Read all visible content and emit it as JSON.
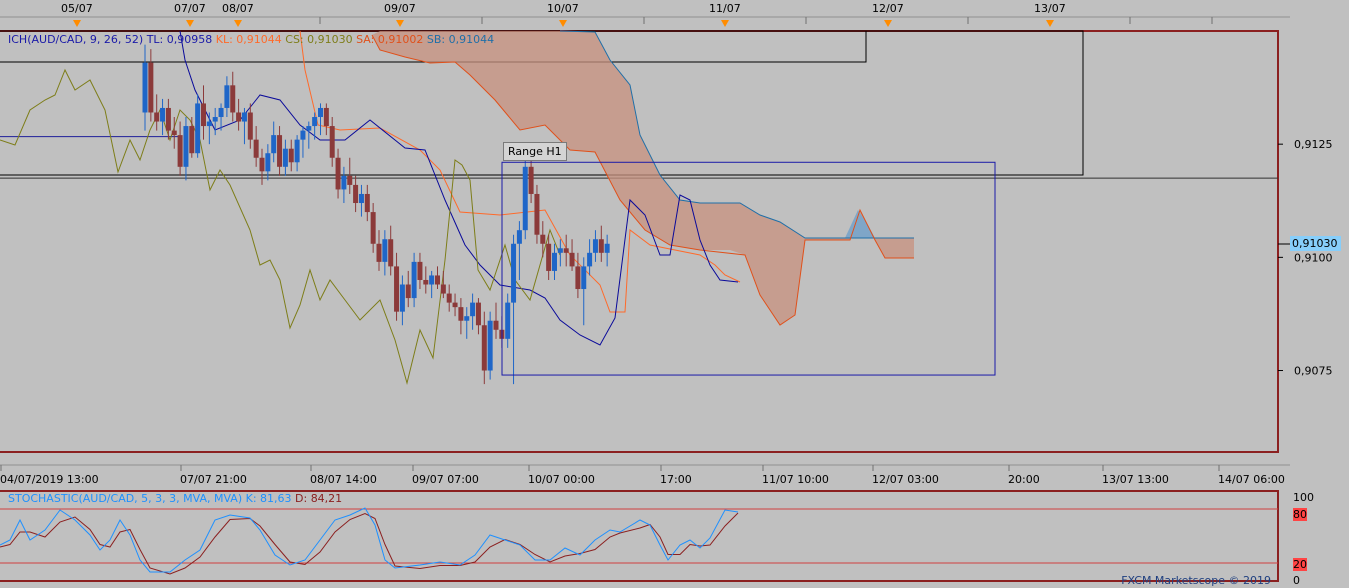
{
  "chart_data": [
    {
      "type": "candlestick",
      "instrument": "AUD/CAD",
      "indicator": {
        "label": "ICH(AUD/CAD, 9, 26, 52)",
        "tl": "TL: 0,90958",
        "kl": "KL: 0,91044",
        "cs": "CS: 0,91030",
        "sa": "SA: 0,91002",
        "sb": "SB: 0,91044"
      },
      "top_date_markers": [
        "05/07",
        "07/07",
        "08/07",
        "09/07",
        "10/07",
        "11/07",
        "12/07",
        "13/07"
      ],
      "x_tick_labels": [
        "04/07/2019 13:00",
        "07/07 21:00",
        "08/07 14:00",
        "09/07 07:00",
        "10/07 00:00",
        "17:00",
        "11/07 10:00",
        "12/07 03:00",
        "20:00",
        "13/07 13:00",
        "14/07 06:00"
      ],
      "y_tick_labels": [
        "0,9125",
        "0,9100",
        "0,9075"
      ],
      "ylim": [
        0.9057,
        0.915
      ],
      "current_price": "0,91030",
      "range_box": {
        "label": "Range H1",
        "high": 0.9121,
        "low": 0.9074
      },
      "horizontal_levels": [
        0.91165,
        0.91175,
        0.9128
      ],
      "candles": [
        [
          0.9132,
          0.9147,
          0.9128,
          0.9143
        ],
        [
          0.9143,
          0.9146,
          0.913,
          0.9132
        ],
        [
          0.9132,
          0.9136,
          0.9128,
          0.913
        ],
        [
          0.913,
          0.9135,
          0.9127,
          0.9133
        ],
        [
          0.9133,
          0.9135,
          0.9126,
          0.9128
        ],
        [
          0.9128,
          0.9131,
          0.9124,
          0.9127
        ],
        [
          0.9127,
          0.913,
          0.9118,
          0.912
        ],
        [
          0.912,
          0.9131,
          0.9117,
          0.9129
        ],
        [
          0.9129,
          0.9131,
          0.9122,
          0.9123
        ],
        [
          0.9123,
          0.9136,
          0.9122,
          0.9134
        ],
        [
          0.9134,
          0.9138,
          0.9126,
          0.9129
        ],
        [
          0.9129,
          0.9132,
          0.9125,
          0.913
        ],
        [
          0.913,
          0.9133,
          0.9127,
          0.9131
        ],
        [
          0.9131,
          0.9134,
          0.9128,
          0.9133
        ],
        [
          0.9133,
          0.914,
          0.9131,
          0.9138
        ],
        [
          0.9138,
          0.9141,
          0.913,
          0.9132
        ],
        [
          0.9132,
          0.9135,
          0.9128,
          0.913
        ],
        [
          0.913,
          0.9133,
          0.9125,
          0.9132
        ],
        [
          0.9132,
          0.9134,
          0.9124,
          0.9126
        ],
        [
          0.9126,
          0.9129,
          0.912,
          0.9122
        ],
        [
          0.9122,
          0.9124,
          0.9116,
          0.9119
        ],
        [
          0.9119,
          0.9125,
          0.9117,
          0.9123
        ],
        [
          0.9123,
          0.913,
          0.9121,
          0.9127
        ],
        [
          0.9127,
          0.9129,
          0.9118,
          0.912
        ],
        [
          0.912,
          0.9126,
          0.9118,
          0.9124
        ],
        [
          0.9124,
          0.9126,
          0.9119,
          0.9121
        ],
        [
          0.9121,
          0.9127,
          0.9119,
          0.9126
        ],
        [
          0.9126,
          0.9129,
          0.9122,
          0.9128
        ],
        [
          0.9128,
          0.913,
          0.9124,
          0.9129
        ],
        [
          0.9129,
          0.9132,
          0.9126,
          0.9131
        ],
        [
          0.9131,
          0.9134,
          0.9127,
          0.9133
        ],
        [
          0.9133,
          0.9134,
          0.9127,
          0.9129
        ],
        [
          0.9129,
          0.9131,
          0.912,
          0.9122
        ],
        [
          0.9122,
          0.9124,
          0.9113,
          0.9115
        ],
        [
          0.9115,
          0.912,
          0.9112,
          0.9118
        ],
        [
          0.9118,
          0.9122,
          0.9114,
          0.9116
        ],
        [
          0.9116,
          0.9118,
          0.911,
          0.9112
        ],
        [
          0.9112,
          0.9116,
          0.9109,
          0.9114
        ],
        [
          0.9114,
          0.9116,
          0.9108,
          0.911
        ],
        [
          0.911,
          0.9112,
          0.9101,
          0.9103
        ],
        [
          0.9103,
          0.9106,
          0.9097,
          0.9099
        ],
        [
          0.9099,
          0.9106,
          0.9096,
          0.9104
        ],
        [
          0.9104,
          0.9107,
          0.9096,
          0.9098
        ],
        [
          0.9098,
          0.9101,
          0.9086,
          0.9088
        ],
        [
          0.9088,
          0.9096,
          0.9085,
          0.9094
        ],
        [
          0.9094,
          0.9097,
          0.9089,
          0.9091
        ],
        [
          0.9091,
          0.9101,
          0.9089,
          0.9099
        ],
        [
          0.9099,
          0.9101,
          0.9093,
          0.9095
        ],
        [
          0.9095,
          0.9098,
          0.9092,
          0.9094
        ],
        [
          0.9094,
          0.9097,
          0.9091,
          0.9096
        ],
        [
          0.9096,
          0.9098,
          0.9093,
          0.9094
        ],
        [
          0.9094,
          0.9097,
          0.9091,
          0.9092
        ],
        [
          0.9092,
          0.9094,
          0.9088,
          0.909
        ],
        [
          0.909,
          0.9092,
          0.9087,
          0.9089
        ],
        [
          0.9089,
          0.9091,
          0.9083,
          0.9086
        ],
        [
          0.9086,
          0.9089,
          0.9082,
          0.9087
        ],
        [
          0.9087,
          0.9092,
          0.9084,
          0.909
        ],
        [
          0.909,
          0.9091,
          0.9083,
          0.9085
        ],
        [
          0.9085,
          0.9088,
          0.9072,
          0.9075
        ],
        [
          0.9075,
          0.9088,
          0.9073,
          0.9086
        ],
        [
          0.9086,
          0.909,
          0.9082,
          0.9084
        ],
        [
          0.9084,
          0.9087,
          0.908,
          0.9082
        ],
        [
          0.9082,
          0.9092,
          0.908,
          0.909
        ],
        [
          0.909,
          0.9105,
          0.9072,
          0.9103
        ],
        [
          0.9103,
          0.9108,
          0.9095,
          0.9106
        ],
        [
          0.9106,
          0.9122,
          0.9104,
          0.912
        ],
        [
          0.912,
          0.9123,
          0.9112,
          0.9114
        ],
        [
          0.9114,
          0.9116,
          0.9103,
          0.9105
        ],
        [
          0.9105,
          0.9108,
          0.91,
          0.9103
        ],
        [
          0.9103,
          0.9105,
          0.9095,
          0.9097
        ],
        [
          0.9097,
          0.9103,
          0.9095,
          0.9101
        ],
        [
          0.9101,
          0.9104,
          0.9098,
          0.9102
        ],
        [
          0.9102,
          0.9105,
          0.9098,
          0.9101
        ],
        [
          0.9101,
          0.9104,
          0.9097,
          0.9098
        ],
        [
          0.9098,
          0.9101,
          0.9091,
          0.9093
        ],
        [
          0.9093,
          0.91,
          0.9085,
          0.9098
        ],
        [
          0.9098,
          0.9104,
          0.9096,
          0.9101
        ],
        [
          0.9101,
          0.9106,
          0.9099,
          0.9104
        ],
        [
          0.9104,
          0.9107,
          0.9099,
          0.9101
        ],
        [
          0.9101,
          0.9105,
          0.9098,
          0.9103
        ]
      ]
    },
    {
      "type": "line",
      "label": "STOCHASTIC(AUD/CAD, 5, 3, 3, MVA, MVA)",
      "k_label": "K: 81,63",
      "d_label": "D: 84,21",
      "ylim": [
        0,
        100
      ],
      "y_tick_labels": [
        "100",
        "80",
        "20",
        "0"
      ],
      "levels": [
        80,
        20
      ]
    }
  ],
  "footer": {
    "watermark": "FXCM Marketscope © 2019"
  }
}
